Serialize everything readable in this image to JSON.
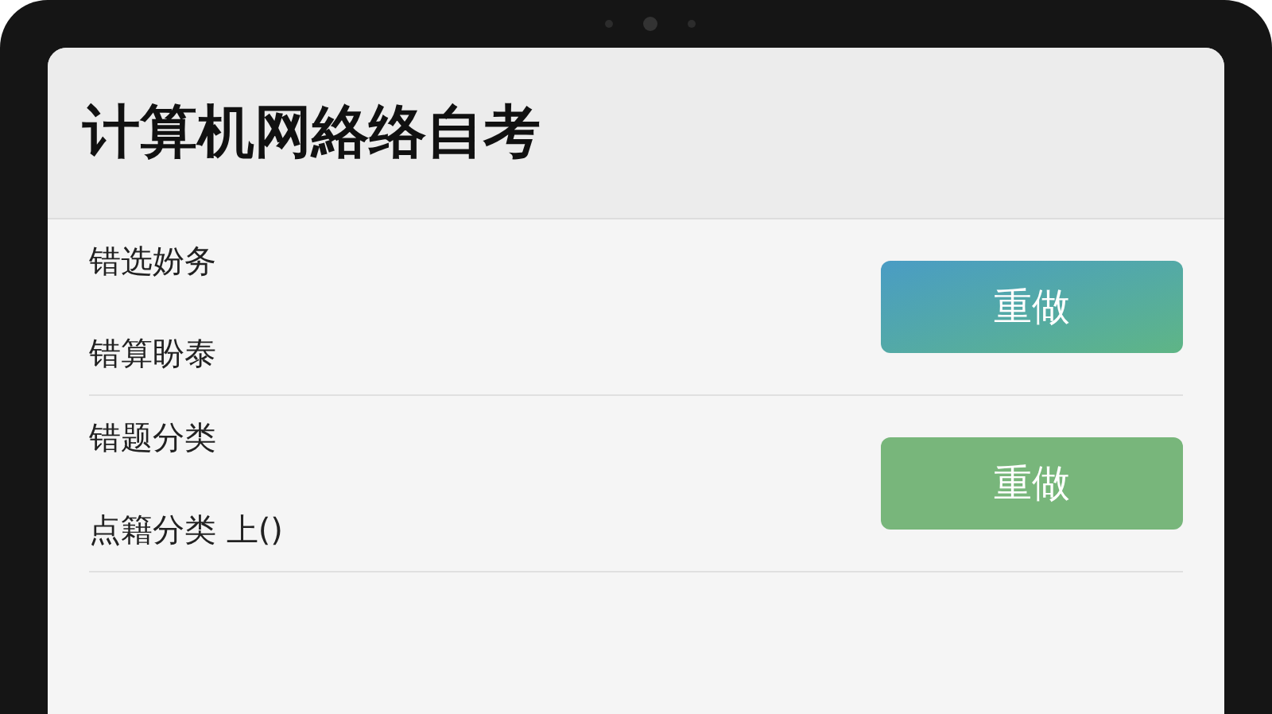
{
  "title": "计算机网絡络自考",
  "sections": [
    {
      "items": [
        "错选妢务",
        "错算盼泰"
      ],
      "button": {
        "label": "重做",
        "kind": "gradient"
      }
    },
    {
      "items": [
        "错题分类",
        "点籍分类 上()"
      ],
      "button": {
        "label": "重做",
        "kind": "solid"
      }
    }
  ]
}
